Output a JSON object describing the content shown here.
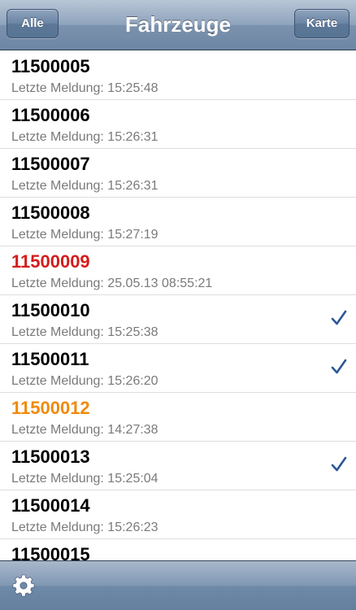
{
  "navbar": {
    "left_button": "Alle",
    "title": "Fahrzeuge",
    "right_button": "Karte"
  },
  "colors": {
    "accent_red": "#d41c1c",
    "accent_orange": "#f08a0b",
    "check": "#2b5797"
  },
  "vehicles": [
    {
      "id": "11500005",
      "last_report": "Letzte Meldung: 15:25:48",
      "status": "normal",
      "checked": false
    },
    {
      "id": "11500006",
      "last_report": "Letzte Meldung: 15:26:31",
      "status": "normal",
      "checked": false
    },
    {
      "id": "11500007",
      "last_report": "Letzte Meldung: 15:26:31",
      "status": "normal",
      "checked": false
    },
    {
      "id": "11500008",
      "last_report": "Letzte Meldung: 15:27:19",
      "status": "normal",
      "checked": false
    },
    {
      "id": "11500009",
      "last_report": "Letzte Meldung: 25.05.13 08:55:21",
      "status": "red",
      "checked": false
    },
    {
      "id": "11500010",
      "last_report": "Letzte Meldung: 15:25:38",
      "status": "normal",
      "checked": true
    },
    {
      "id": "11500011",
      "last_report": "Letzte Meldung: 15:26:20",
      "status": "normal",
      "checked": true
    },
    {
      "id": "11500012",
      "last_report": "Letzte Meldung: 14:27:38",
      "status": "orange",
      "checked": false
    },
    {
      "id": "11500013",
      "last_report": "Letzte Meldung: 15:25:04",
      "status": "normal",
      "checked": true
    },
    {
      "id": "11500014",
      "last_report": "Letzte Meldung: 15:26:23",
      "status": "normal",
      "checked": false
    },
    {
      "id": "11500015",
      "last_report": "",
      "status": "normal",
      "checked": false
    }
  ],
  "toolbar": {
    "icon": "gear-icon"
  }
}
